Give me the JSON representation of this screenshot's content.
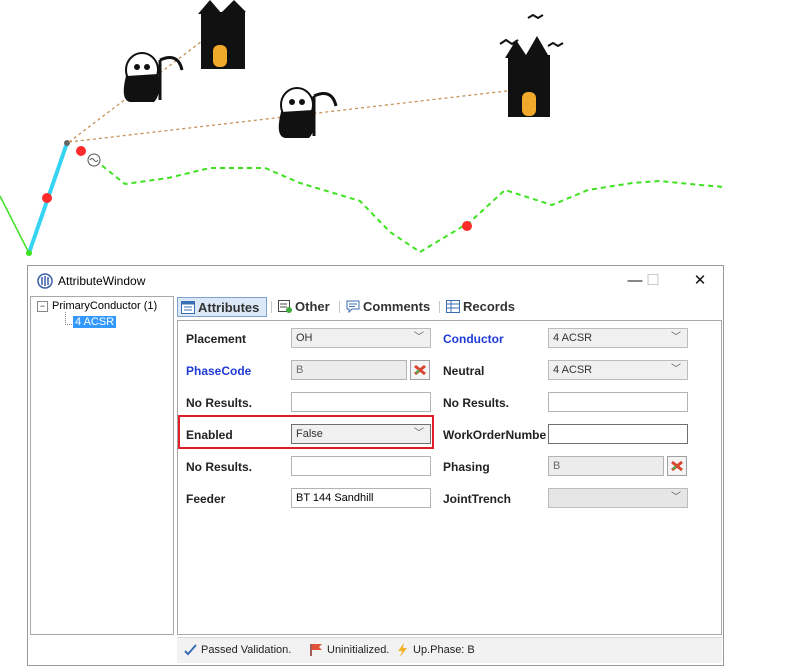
{
  "window": {
    "title": "AttributeWindow",
    "controls": {
      "minimize": "—",
      "maximize": "☐",
      "close": "✕"
    }
  },
  "tree": {
    "root_label": "PrimaryConductor (1)",
    "toggle": "−",
    "child_label": "4 ACSR"
  },
  "tabs": [
    {
      "label": "Attributes",
      "icon": "attributes-icon"
    },
    {
      "label": "Other",
      "icon": "other-icon"
    },
    {
      "label": "Comments",
      "icon": "comments-icon"
    },
    {
      "label": "Records",
      "icon": "records-icon"
    }
  ],
  "form": {
    "left": [
      {
        "label": "Placement",
        "value": "OH",
        "kind": "dropdown"
      },
      {
        "label": "PhaseCode",
        "value": "B",
        "kind": "readonly-clear"
      },
      {
        "label": "No Results.",
        "value": "",
        "kind": "text"
      },
      {
        "label": "Enabled",
        "value": "False",
        "kind": "dropdown"
      },
      {
        "label": "No Results.",
        "value": "",
        "kind": "text"
      },
      {
        "label": "Feeder",
        "value": "BT 144 Sandhill",
        "kind": "text"
      }
    ],
    "right": [
      {
        "label": "Conductor",
        "value": "4 ACSR",
        "kind": "dropdown"
      },
      {
        "label": "Neutral",
        "value": "4 ACSR",
        "kind": "dropdown"
      },
      {
        "label": "No Results.",
        "value": "",
        "kind": "text"
      },
      {
        "label": "WorkOrderNumbe",
        "value": "",
        "kind": "text"
      },
      {
        "label": "Phasing",
        "value": "B",
        "kind": "readonly-clear"
      },
      {
        "label": "JointTrench",
        "value": "",
        "kind": "dropdown"
      }
    ],
    "link_label_color": "#1f3bd6",
    "highlight_color": "#e01e2a"
  },
  "status": [
    {
      "text": "Passed Validation.",
      "icon": "validation-check-icon"
    },
    {
      "text": "Uninitialized.",
      "icon": "flag-icon"
    },
    {
      "text": "Up.Phase: B",
      "icon": "lightning-icon"
    }
  ],
  "map": {
    "icons": [
      "castle-icon",
      "grim-reaper-icon",
      "grim-reaper-icon",
      "castle-bats-icon"
    ],
    "colors": {
      "conductor_selected": "#35d4f2",
      "conductor_green": "#3de321",
      "trace_dashed": "#c8925a",
      "vertex": "#ff2b2b"
    }
  }
}
